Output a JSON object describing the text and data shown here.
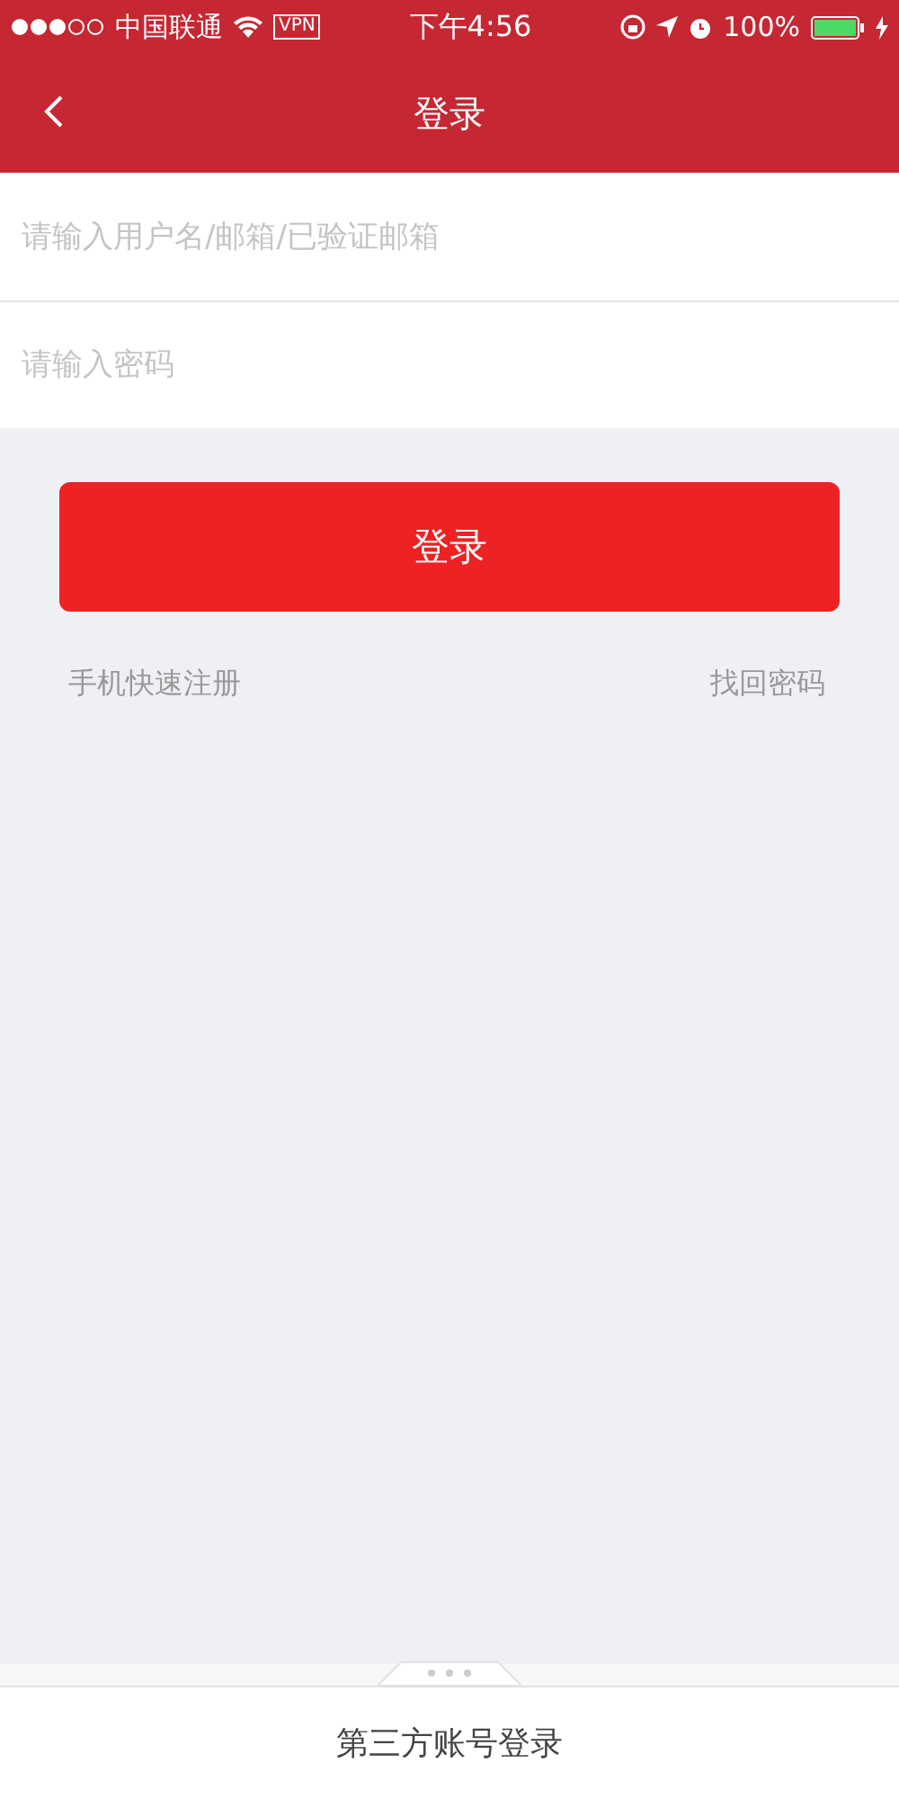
{
  "status_bar": {
    "carrier": "中国联通",
    "vpn": "VPN",
    "time": "下午4:56",
    "battery": "100%"
  },
  "nav_bar": {
    "title": "登录"
  },
  "fields": [
    {
      "placeholder": "请输入用户名/邮箱/已验证邮箱"
    },
    {
      "placeholder": "请输入密码"
    }
  ],
  "login_button": "登录",
  "links": [
    "手机快速注册",
    "找回密码"
  ],
  "bottom_panel": {
    "label": "第三方账号登录"
  }
}
